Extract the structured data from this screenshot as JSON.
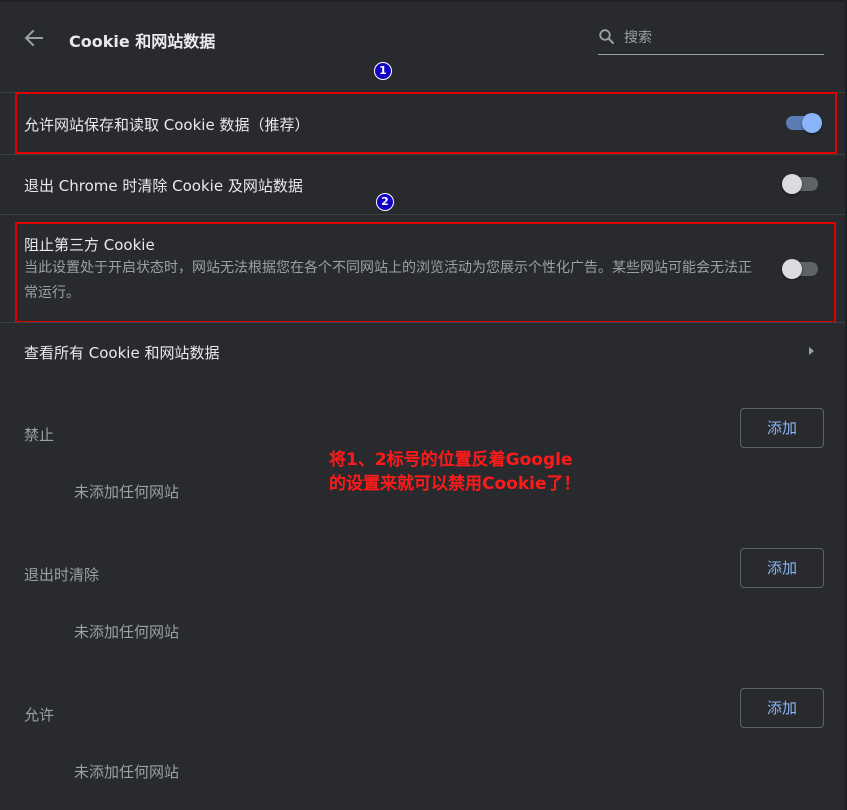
{
  "header": {
    "title": "Cookie 和网站数据",
    "search_placeholder": "搜索",
    "back_icon": "arrow-left-icon",
    "search_icon": "magnifier-icon"
  },
  "markers": {
    "one": "1",
    "two": "2"
  },
  "settings": {
    "allow_cookies": {
      "label": "允许网站保存和读取 Cookie 数据（推荐）",
      "enabled": true
    },
    "clear_on_exit": {
      "label": "退出 Chrome 时清除 Cookie 及网站数据",
      "enabled": false
    },
    "block_third_party": {
      "label": "阻止第三方 Cookie",
      "description": "当此设置处于开启状态时，网站无法根据您在各个不同网站上的浏览活动为您展示个性化广告。某些网站可能会无法正常运行。",
      "enabled": false
    },
    "see_all": {
      "label": "查看所有 Cookie 和网站数据"
    }
  },
  "sections": [
    {
      "title": "禁止",
      "empty_text": "未添加任何网站",
      "add_label": "添加"
    },
    {
      "title": "退出时清除",
      "empty_text": "未添加任何网站",
      "add_label": "添加"
    },
    {
      "title": "允许",
      "empty_text": "未添加任何网站",
      "add_label": "添加"
    }
  ],
  "annotation": {
    "line1": "将1、2标号的位置反着Google",
    "line2": "的设置来就可以禁用Cookie了！"
  },
  "colors": {
    "background": "#292a2d",
    "accent": "#8ab4f8",
    "highlight": "#e00000",
    "marker": "#1200c4",
    "annotation": "#ff1a1a"
  }
}
